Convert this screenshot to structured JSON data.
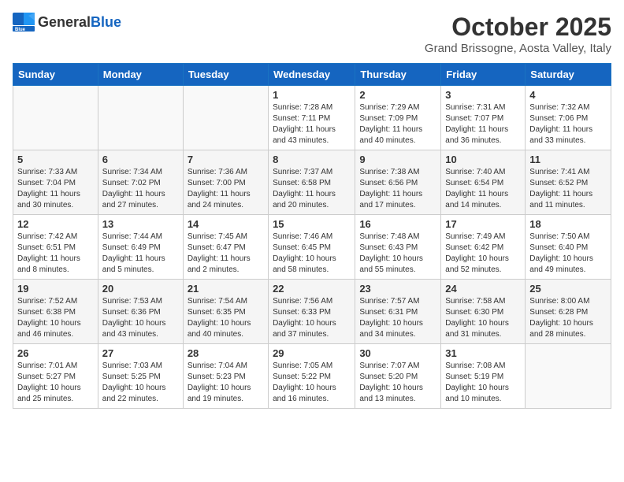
{
  "header": {
    "logo_general": "General",
    "logo_blue": "Blue",
    "month": "October 2025",
    "location": "Grand Brissogne, Aosta Valley, Italy"
  },
  "days_of_week": [
    "Sunday",
    "Monday",
    "Tuesday",
    "Wednesday",
    "Thursday",
    "Friday",
    "Saturday"
  ],
  "weeks": [
    [
      {
        "day": "",
        "info": ""
      },
      {
        "day": "",
        "info": ""
      },
      {
        "day": "",
        "info": ""
      },
      {
        "day": "1",
        "info": "Sunrise: 7:28 AM\nSunset: 7:11 PM\nDaylight: 11 hours\nand 43 minutes."
      },
      {
        "day": "2",
        "info": "Sunrise: 7:29 AM\nSunset: 7:09 PM\nDaylight: 11 hours\nand 40 minutes."
      },
      {
        "day": "3",
        "info": "Sunrise: 7:31 AM\nSunset: 7:07 PM\nDaylight: 11 hours\nand 36 minutes."
      },
      {
        "day": "4",
        "info": "Sunrise: 7:32 AM\nSunset: 7:06 PM\nDaylight: 11 hours\nand 33 minutes."
      }
    ],
    [
      {
        "day": "5",
        "info": "Sunrise: 7:33 AM\nSunset: 7:04 PM\nDaylight: 11 hours\nand 30 minutes."
      },
      {
        "day": "6",
        "info": "Sunrise: 7:34 AM\nSunset: 7:02 PM\nDaylight: 11 hours\nand 27 minutes."
      },
      {
        "day": "7",
        "info": "Sunrise: 7:36 AM\nSunset: 7:00 PM\nDaylight: 11 hours\nand 24 minutes."
      },
      {
        "day": "8",
        "info": "Sunrise: 7:37 AM\nSunset: 6:58 PM\nDaylight: 11 hours\nand 20 minutes."
      },
      {
        "day": "9",
        "info": "Sunrise: 7:38 AM\nSunset: 6:56 PM\nDaylight: 11 hours\nand 17 minutes."
      },
      {
        "day": "10",
        "info": "Sunrise: 7:40 AM\nSunset: 6:54 PM\nDaylight: 11 hours\nand 14 minutes."
      },
      {
        "day": "11",
        "info": "Sunrise: 7:41 AM\nSunset: 6:52 PM\nDaylight: 11 hours\nand 11 minutes."
      }
    ],
    [
      {
        "day": "12",
        "info": "Sunrise: 7:42 AM\nSunset: 6:51 PM\nDaylight: 11 hours\nand 8 minutes."
      },
      {
        "day": "13",
        "info": "Sunrise: 7:44 AM\nSunset: 6:49 PM\nDaylight: 11 hours\nand 5 minutes."
      },
      {
        "day": "14",
        "info": "Sunrise: 7:45 AM\nSunset: 6:47 PM\nDaylight: 11 hours\nand 2 minutes."
      },
      {
        "day": "15",
        "info": "Sunrise: 7:46 AM\nSunset: 6:45 PM\nDaylight: 10 hours\nand 58 minutes."
      },
      {
        "day": "16",
        "info": "Sunrise: 7:48 AM\nSunset: 6:43 PM\nDaylight: 10 hours\nand 55 minutes."
      },
      {
        "day": "17",
        "info": "Sunrise: 7:49 AM\nSunset: 6:42 PM\nDaylight: 10 hours\nand 52 minutes."
      },
      {
        "day": "18",
        "info": "Sunrise: 7:50 AM\nSunset: 6:40 PM\nDaylight: 10 hours\nand 49 minutes."
      }
    ],
    [
      {
        "day": "19",
        "info": "Sunrise: 7:52 AM\nSunset: 6:38 PM\nDaylight: 10 hours\nand 46 minutes."
      },
      {
        "day": "20",
        "info": "Sunrise: 7:53 AM\nSunset: 6:36 PM\nDaylight: 10 hours\nand 43 minutes."
      },
      {
        "day": "21",
        "info": "Sunrise: 7:54 AM\nSunset: 6:35 PM\nDaylight: 10 hours\nand 40 minutes."
      },
      {
        "day": "22",
        "info": "Sunrise: 7:56 AM\nSunset: 6:33 PM\nDaylight: 10 hours\nand 37 minutes."
      },
      {
        "day": "23",
        "info": "Sunrise: 7:57 AM\nSunset: 6:31 PM\nDaylight: 10 hours\nand 34 minutes."
      },
      {
        "day": "24",
        "info": "Sunrise: 7:58 AM\nSunset: 6:30 PM\nDaylight: 10 hours\nand 31 minutes."
      },
      {
        "day": "25",
        "info": "Sunrise: 8:00 AM\nSunset: 6:28 PM\nDaylight: 10 hours\nand 28 minutes."
      }
    ],
    [
      {
        "day": "26",
        "info": "Sunrise: 7:01 AM\nSunset: 5:27 PM\nDaylight: 10 hours\nand 25 minutes."
      },
      {
        "day": "27",
        "info": "Sunrise: 7:03 AM\nSunset: 5:25 PM\nDaylight: 10 hours\nand 22 minutes."
      },
      {
        "day": "28",
        "info": "Sunrise: 7:04 AM\nSunset: 5:23 PM\nDaylight: 10 hours\nand 19 minutes."
      },
      {
        "day": "29",
        "info": "Sunrise: 7:05 AM\nSunset: 5:22 PM\nDaylight: 10 hours\nand 16 minutes."
      },
      {
        "day": "30",
        "info": "Sunrise: 7:07 AM\nSunset: 5:20 PM\nDaylight: 10 hours\nand 13 minutes."
      },
      {
        "day": "31",
        "info": "Sunrise: 7:08 AM\nSunset: 5:19 PM\nDaylight: 10 hours\nand 10 minutes."
      },
      {
        "day": "",
        "info": ""
      }
    ]
  ]
}
